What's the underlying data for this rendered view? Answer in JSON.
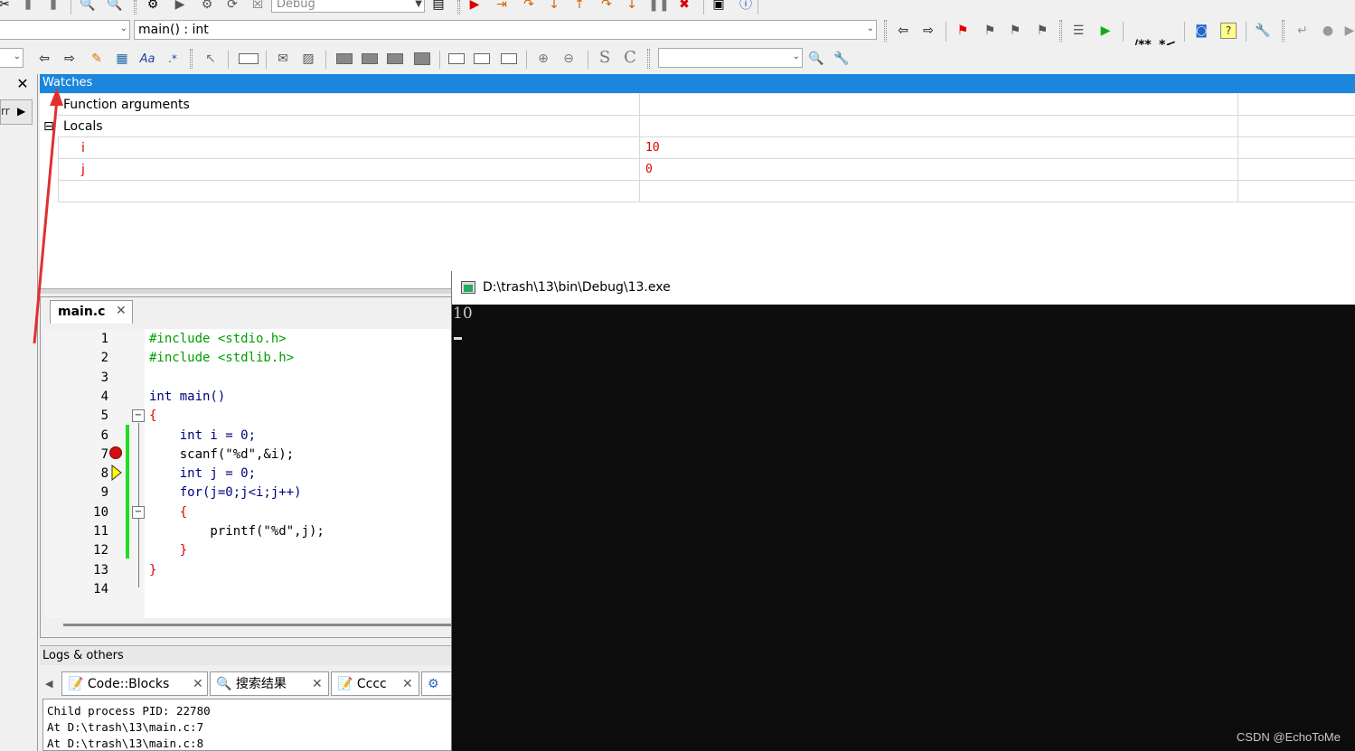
{
  "toolbar": {
    "build_target": "Debug",
    "function_combo": "main() : int",
    "search_combo": "",
    "doc_comment_label": "/**",
    "doc_comment2_label": "*<"
  },
  "watches": {
    "title": "Watches",
    "rows": [
      {
        "name": "Function arguments",
        "value": ""
      },
      {
        "name": "Locals",
        "value": ""
      },
      {
        "name": "i",
        "value": "10"
      },
      {
        "name": "j",
        "value": "0"
      }
    ],
    "collapse_symbol": "⊟"
  },
  "editor": {
    "tab_label": "main.c",
    "line_numbers": [
      "1",
      "2",
      "3",
      "4",
      "5",
      "6",
      "7",
      "8",
      "9",
      "10",
      "11",
      "12",
      "13",
      "14"
    ],
    "lines": [
      "#include <stdio.h>",
      "#include <stdlib.h>",
      "",
      "int main()",
      "{",
      "    int i = 0;",
      "    scanf(\"%d\",&i);",
      "    int j = 0;",
      "    for(j=0;j<i;j++)",
      "    {",
      "        printf(\"%d\",j);",
      "    }",
      "}",
      ""
    ]
  },
  "logs": {
    "title": "Logs & others",
    "tabs": [
      "Code::Blocks",
      "搜索结果",
      "Cccc"
    ],
    "lines": [
      "Child process PID: 22780",
      "At D:\\trash\\13\\main.c:7",
      "At D:\\trash\\13\\main.c:8"
    ]
  },
  "console": {
    "title": "D:\\trash\\13\\bin\\Debug\\13.exe",
    "output": "10"
  },
  "watermark": "CSDN @EchoToMe",
  "colors": {
    "accent": "#1b86dc",
    "value_red": "#e00000",
    "keyword_blue": "#00007f",
    "preproc_green": "#00a000",
    "breakpoint_red": "#d01010",
    "changebar_green": "#22dd22"
  }
}
